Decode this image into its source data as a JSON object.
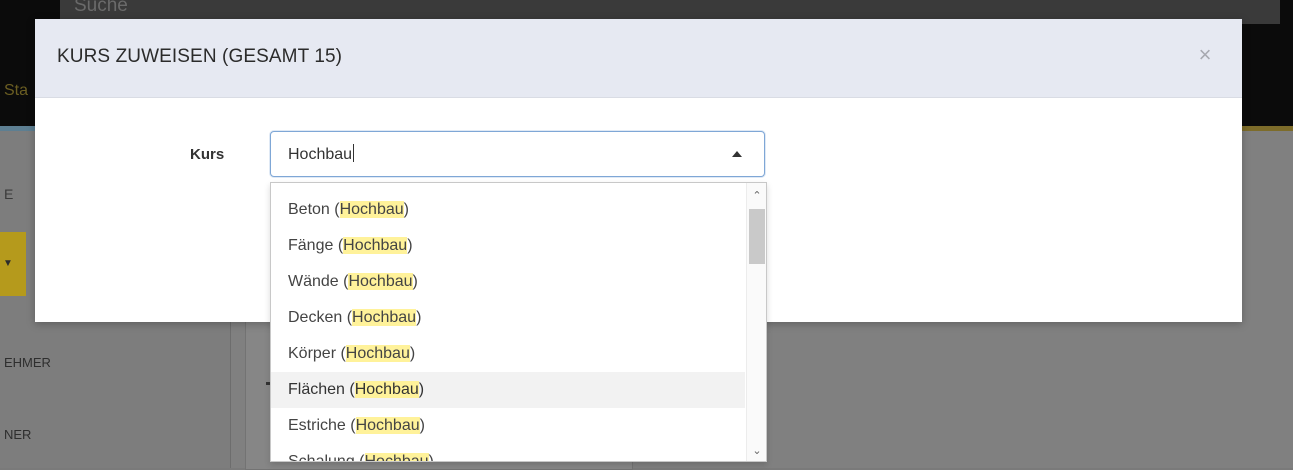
{
  "background": {
    "search_placeholder": "Suche",
    "status_fragment": "Sta",
    "e_label": "E",
    "nav_item_1": "EHMER",
    "nav_item_2": "NER"
  },
  "modal": {
    "title": "KURS ZUWEISEN (GESAMT 15)",
    "close_symbol": "×",
    "field_label": "Kurs",
    "input_value": "Hochbau",
    "highlight_term": "Hochbau"
  },
  "dropdown": {
    "options": [
      {
        "name": "Beton",
        "suffix": "Hochbau"
      },
      {
        "name": "Fänge",
        "suffix": "Hochbau"
      },
      {
        "name": "Wände",
        "suffix": "Hochbau"
      },
      {
        "name": "Decken",
        "suffix": "Hochbau"
      },
      {
        "name": "Körper",
        "suffix": "Hochbau"
      },
      {
        "name": "Flächen",
        "suffix": "Hochbau"
      },
      {
        "name": "Estriche",
        "suffix": "Hochbau"
      },
      {
        "name": "Schalung",
        "suffix": "Hochbau"
      }
    ],
    "active_index": 5
  },
  "colors": {
    "header_bg": "#e6e9f2",
    "highlight": "#fff29a",
    "focus_border": "#7fa7d6"
  }
}
